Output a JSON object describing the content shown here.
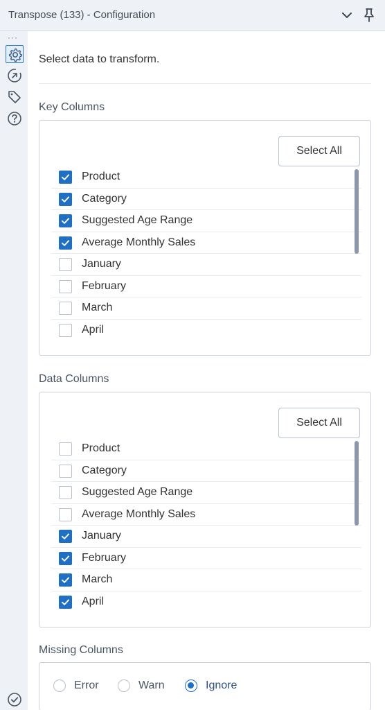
{
  "window": {
    "title": "Transpose (133) - Configuration",
    "rail_menu": "···"
  },
  "description": "Select data to transform.",
  "key_columns": {
    "label": "Key Columns",
    "select_all_label": "Select All",
    "items": [
      {
        "label": "Product",
        "checked": true
      },
      {
        "label": "Category",
        "checked": true
      },
      {
        "label": "Suggested Age Range",
        "checked": true
      },
      {
        "label": "Average Monthly Sales",
        "checked": true
      },
      {
        "label": "January",
        "checked": false
      },
      {
        "label": "February",
        "checked": false
      },
      {
        "label": "March",
        "checked": false
      },
      {
        "label": "April",
        "checked": false
      }
    ]
  },
  "data_columns": {
    "label": "Data Columns",
    "select_all_label": "Select All",
    "items": [
      {
        "label": "Product",
        "checked": false
      },
      {
        "label": "Category",
        "checked": false
      },
      {
        "label": "Suggested Age Range",
        "checked": false
      },
      {
        "label": "Average Monthly Sales",
        "checked": false
      },
      {
        "label": "January",
        "checked": true
      },
      {
        "label": "February",
        "checked": true
      },
      {
        "label": "March",
        "checked": true
      },
      {
        "label": "April",
        "checked": true
      }
    ]
  },
  "missing_columns": {
    "label": "Missing Columns",
    "options": [
      {
        "label": "Error",
        "selected": false
      },
      {
        "label": "Warn",
        "selected": false
      },
      {
        "label": "Ignore",
        "selected": true
      }
    ]
  },
  "icons": {
    "collapse": "chevron-down-icon",
    "pin": "pin-icon",
    "configuration": "gear-icon",
    "annotation": "arrow-circle-icon",
    "tag": "tag-icon",
    "help": "help-icon",
    "status": "check-circle-icon"
  },
  "colors": {
    "accent": "#1f6fc5",
    "rail_background": "#eef1f6",
    "scrollbar": "#8b97ab"
  }
}
